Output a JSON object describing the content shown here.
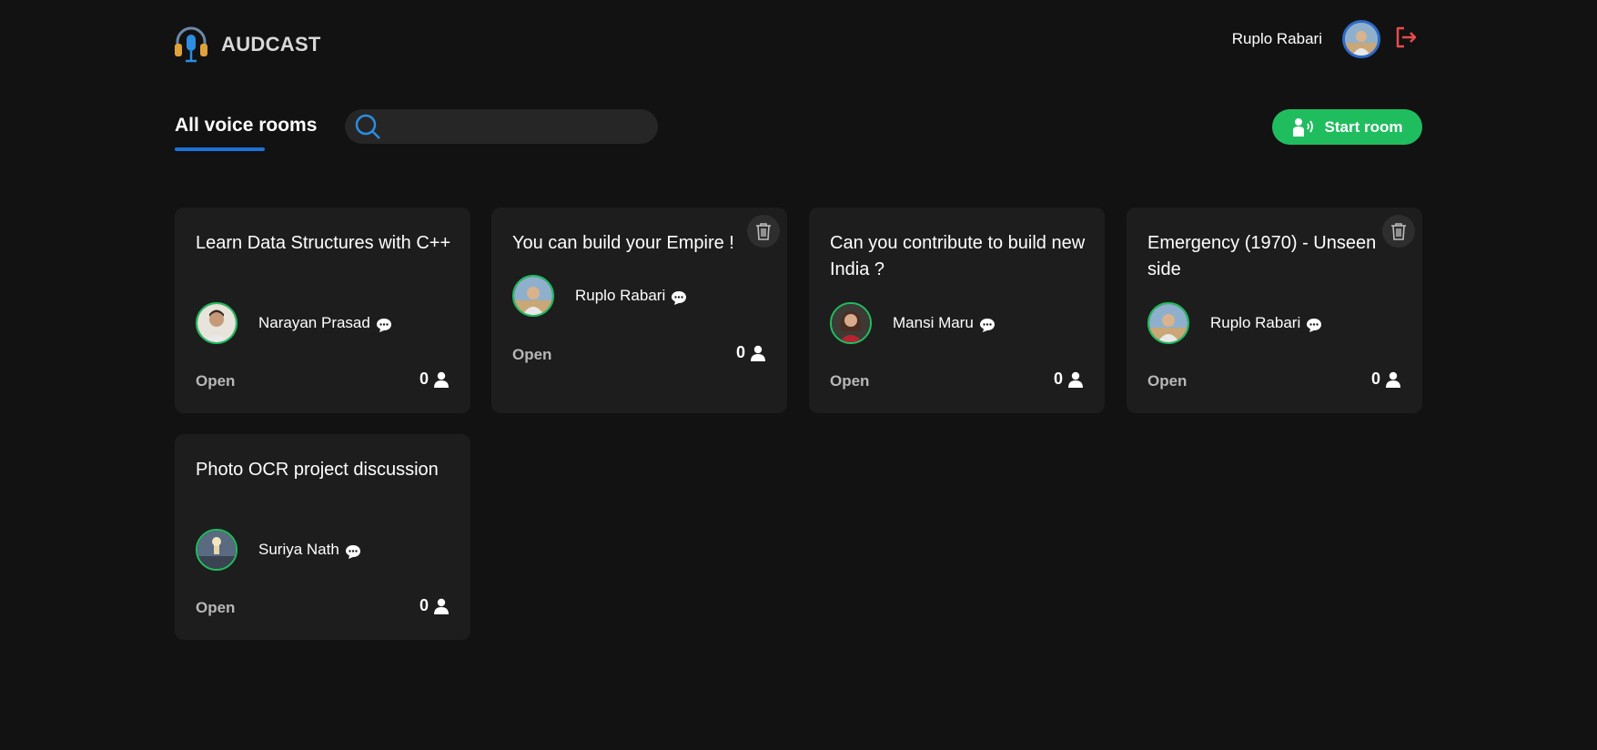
{
  "app": {
    "name": "AUDCAST"
  },
  "header": {
    "user_name": "Ruplo Rabari",
    "avatar_icon": "user-avatar",
    "logout_icon": "logout-icon"
  },
  "toolbar": {
    "heading": "All voice rooms",
    "search_placeholder": "",
    "search_value": "",
    "start_room_label": "Start room"
  },
  "colors": {
    "accent_green": "#20bd5f",
    "accent_blue": "#1b72d8",
    "logout_red": "#e74c4c",
    "card_bg": "#1d1d1d",
    "page_bg": "#121212"
  },
  "rooms": [
    {
      "title": "Learn Data Structures with C++",
      "speaker": "Narayan Prasad",
      "status": "Open",
      "listeners": "0",
      "deletable": false
    },
    {
      "title": "You can build your Empire !",
      "speaker": "Ruplo Rabari",
      "status": "Open",
      "listeners": "0",
      "deletable": true
    },
    {
      "title": "Can you contribute to build new India ?",
      "speaker": "Mansi Maru",
      "status": "Open",
      "listeners": "0",
      "deletable": false
    },
    {
      "title": "Emergency (1970) - Unseen side",
      "speaker": "Ruplo Rabari",
      "status": "Open",
      "listeners": "0",
      "deletable": true
    },
    {
      "title": "Photo OCR project discussion",
      "speaker": "Suriya Nath",
      "status": "Open",
      "listeners": "0",
      "deletable": false
    }
  ]
}
